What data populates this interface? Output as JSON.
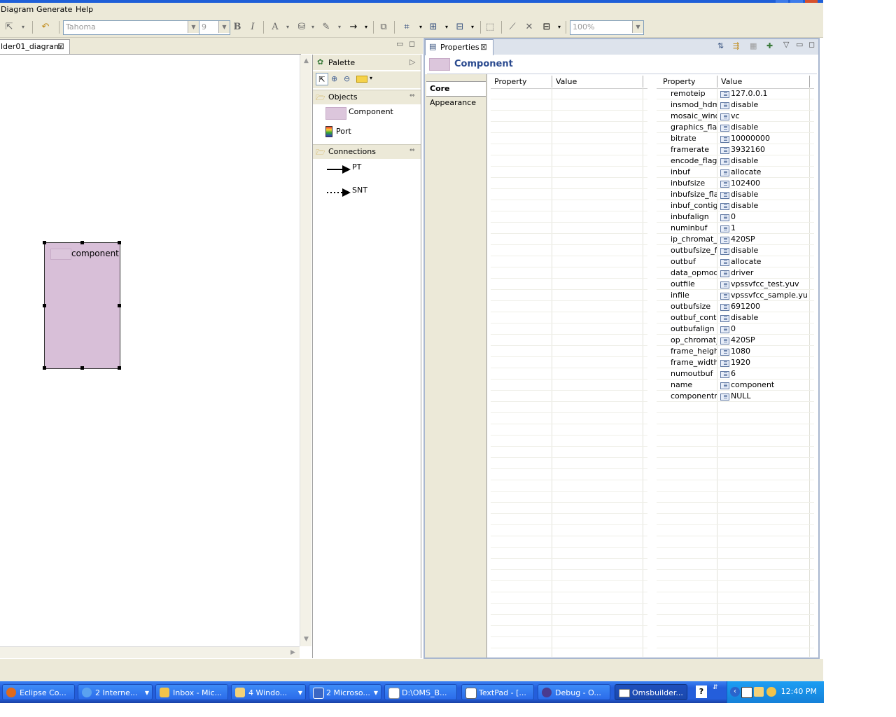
{
  "menu": {
    "items": [
      "Diagram",
      "Generate",
      "Help"
    ]
  },
  "toolbar": {
    "font_name": "Tahoma",
    "font_size": "9",
    "bold": "B",
    "italic": "I",
    "font_color": "A",
    "zoom": "100%"
  },
  "editor": {
    "tab_label": "lder01_diagram",
    "component_label": "component"
  },
  "palette": {
    "title": "Palette",
    "objects_drawer": "Objects",
    "objects": [
      "Component",
      "Port"
    ],
    "connections_drawer": "Connections",
    "connections": [
      "PT",
      "SNT"
    ]
  },
  "properties": {
    "tab_label": "Properties",
    "header_title": "Component",
    "side_tabs": [
      "Core",
      "Appearance"
    ],
    "left_columns": [
      "Property",
      "Value"
    ],
    "right_columns": [
      "Property",
      "Value"
    ],
    "rows": [
      {
        "property": "remoteip",
        "value": "127.0.0.1"
      },
      {
        "property": "insmod_hdmi",
        "value": "disable"
      },
      {
        "property": "mosaic_windo",
        "value": "vc"
      },
      {
        "property": "graphics_flag",
        "value": "disable"
      },
      {
        "property": "bitrate",
        "value": "10000000"
      },
      {
        "property": "framerate",
        "value": "3932160"
      },
      {
        "property": "encode_flag",
        "value": "disable"
      },
      {
        "property": "inbuf",
        "value": "allocate"
      },
      {
        "property": "inbufsize",
        "value": "102400"
      },
      {
        "property": "inbufsize_flag",
        "value": "disable"
      },
      {
        "property": "inbuf_contig",
        "value": "disable"
      },
      {
        "property": "inbufalign",
        "value": "0"
      },
      {
        "property": "numinbuf",
        "value": "1"
      },
      {
        "property": "ip_chromat_fc",
        "value": "420SP"
      },
      {
        "property": "outbufsize_fla",
        "value": "disable"
      },
      {
        "property": "outbuf",
        "value": "allocate"
      },
      {
        "property": "data_opmode",
        "value": "driver"
      },
      {
        "property": "outfile",
        "value": "vpssvfcc_test.yuv"
      },
      {
        "property": "infile",
        "value": "vpssvfcc_sample.yuv"
      },
      {
        "property": "outbufsize",
        "value": "691200"
      },
      {
        "property": "outbuf_contig",
        "value": "disable"
      },
      {
        "property": "outbufalign",
        "value": "0"
      },
      {
        "property": "op_chromat_f",
        "value": "420SP"
      },
      {
        "property": "frame_height",
        "value": "1080"
      },
      {
        "property": "frame_width",
        "value": "1920"
      },
      {
        "property": "numoutbuf",
        "value": "6"
      },
      {
        "property": "name",
        "value": "component"
      },
      {
        "property": "componentnar",
        "value": "NULL"
      }
    ]
  },
  "taskbar": {
    "tasks": [
      "Eclipse Co...",
      "2 Interne...",
      "Inbox - Mic...",
      "4 Windo...",
      "2 Microso...",
      "D:\\OMS_B...",
      "TextPad - [...",
      "Debug - O...",
      "Omsbuilder..."
    ],
    "time": "12:40 PM"
  },
  "colors": {
    "component_fill": "#d8bfd8",
    "taskbar_blue": "#245edb",
    "properties_border": "#a9b7cf",
    "header_text": "#2a4a8f"
  }
}
